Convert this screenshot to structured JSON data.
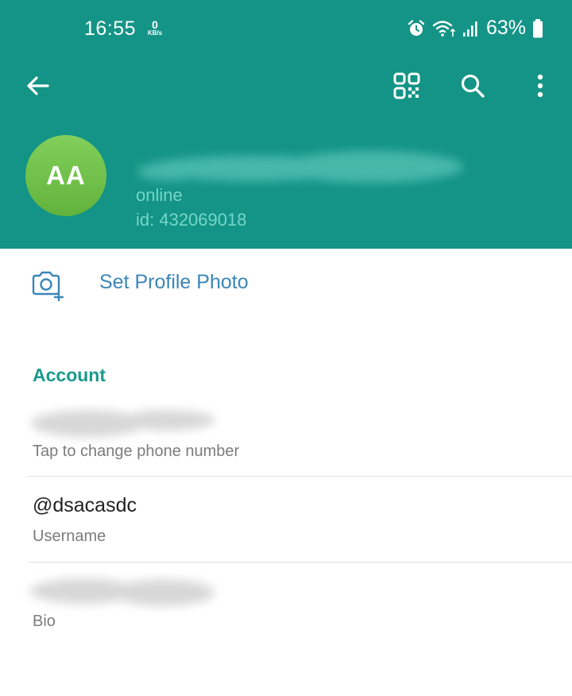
{
  "colors": {
    "header": "#149486",
    "accent": "#1a9a8c",
    "link": "#3c86b9",
    "secondary_text": "#7c7c7c"
  },
  "status_bar": {
    "time": "16:55",
    "net_speed_value": "0",
    "net_speed_unit": "KB/s",
    "battery": "63%",
    "icons": [
      "alarm-icon",
      "wifi-icon",
      "signal-icon",
      "battery-icon"
    ]
  },
  "toolbar": {
    "icons": [
      "back-arrow-icon",
      "qr-code-icon",
      "search-icon",
      "more-vert-icon"
    ]
  },
  "profile": {
    "initials": "AA",
    "status": "online",
    "id": "id: 432069018"
  },
  "set_photo": {
    "label": "Set Profile Photo",
    "icon": "camera-plus-icon"
  },
  "account": {
    "title": "Account",
    "phone_hint": "Tap to change phone number",
    "username_value": "@dsacasdc",
    "username_label": "Username",
    "bio_label": "Bio"
  }
}
